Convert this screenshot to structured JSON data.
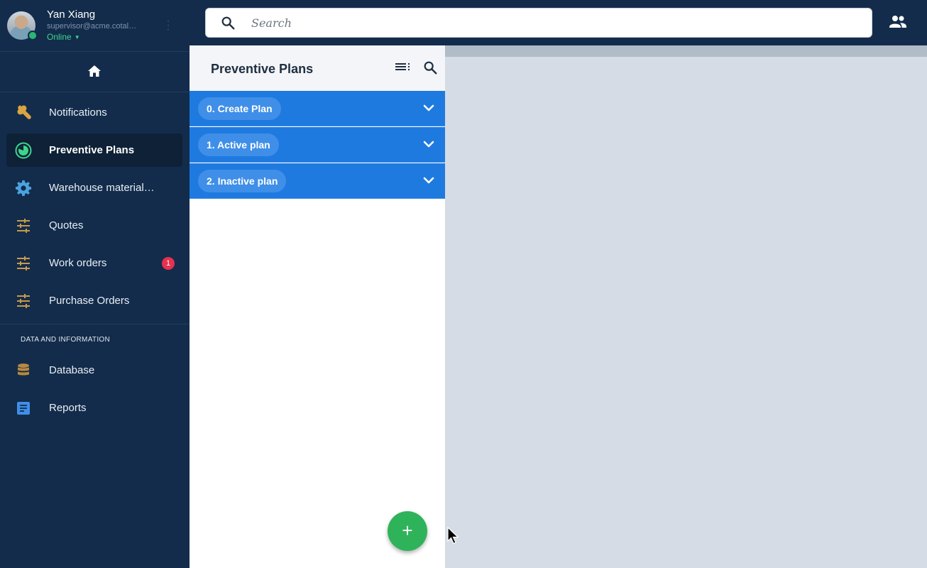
{
  "user": {
    "name": "Yan Xiang",
    "email": "supervisor@acme.cotal…",
    "status": "Online"
  },
  "search": {
    "placeholder": "Search"
  },
  "sidebar": {
    "items": [
      {
        "label": "Notifications",
        "icon": "wrench-icon",
        "color": "#d9a441"
      },
      {
        "label": "Preventive Plans",
        "icon": "timer-icon",
        "color": "#3dd68c",
        "active": true
      },
      {
        "label": "Warehouse material…",
        "icon": "gear-icon",
        "color": "#4aa3e0"
      },
      {
        "label": "Quotes",
        "icon": "sliders-icon",
        "color": "#c99a4a"
      },
      {
        "label": "Work orders",
        "icon": "sliders-icon",
        "color": "#c99a4a",
        "badge": "1"
      },
      {
        "label": "Purchase Orders",
        "icon": "sliders-icon",
        "color": "#c99a4a"
      }
    ],
    "section_title": "DATA AND INFORMATION",
    "data_items": [
      {
        "label": "Database",
        "icon": "database-icon",
        "color": "#b8893e"
      },
      {
        "label": "Reports",
        "icon": "document-icon",
        "color": "#3f8fe8"
      }
    ]
  },
  "panel": {
    "title": "Preventive Plans",
    "groups": [
      {
        "label": "0. Create Plan"
      },
      {
        "label": "1. Active plan"
      },
      {
        "label": "2. Inactive plan"
      }
    ],
    "fab_label": "+"
  },
  "colors": {
    "sidebar_bg": "#132c4b",
    "group_bg": "#1f7ae0",
    "fab_bg": "#2fb35a",
    "badge_bg": "#e8304f"
  }
}
